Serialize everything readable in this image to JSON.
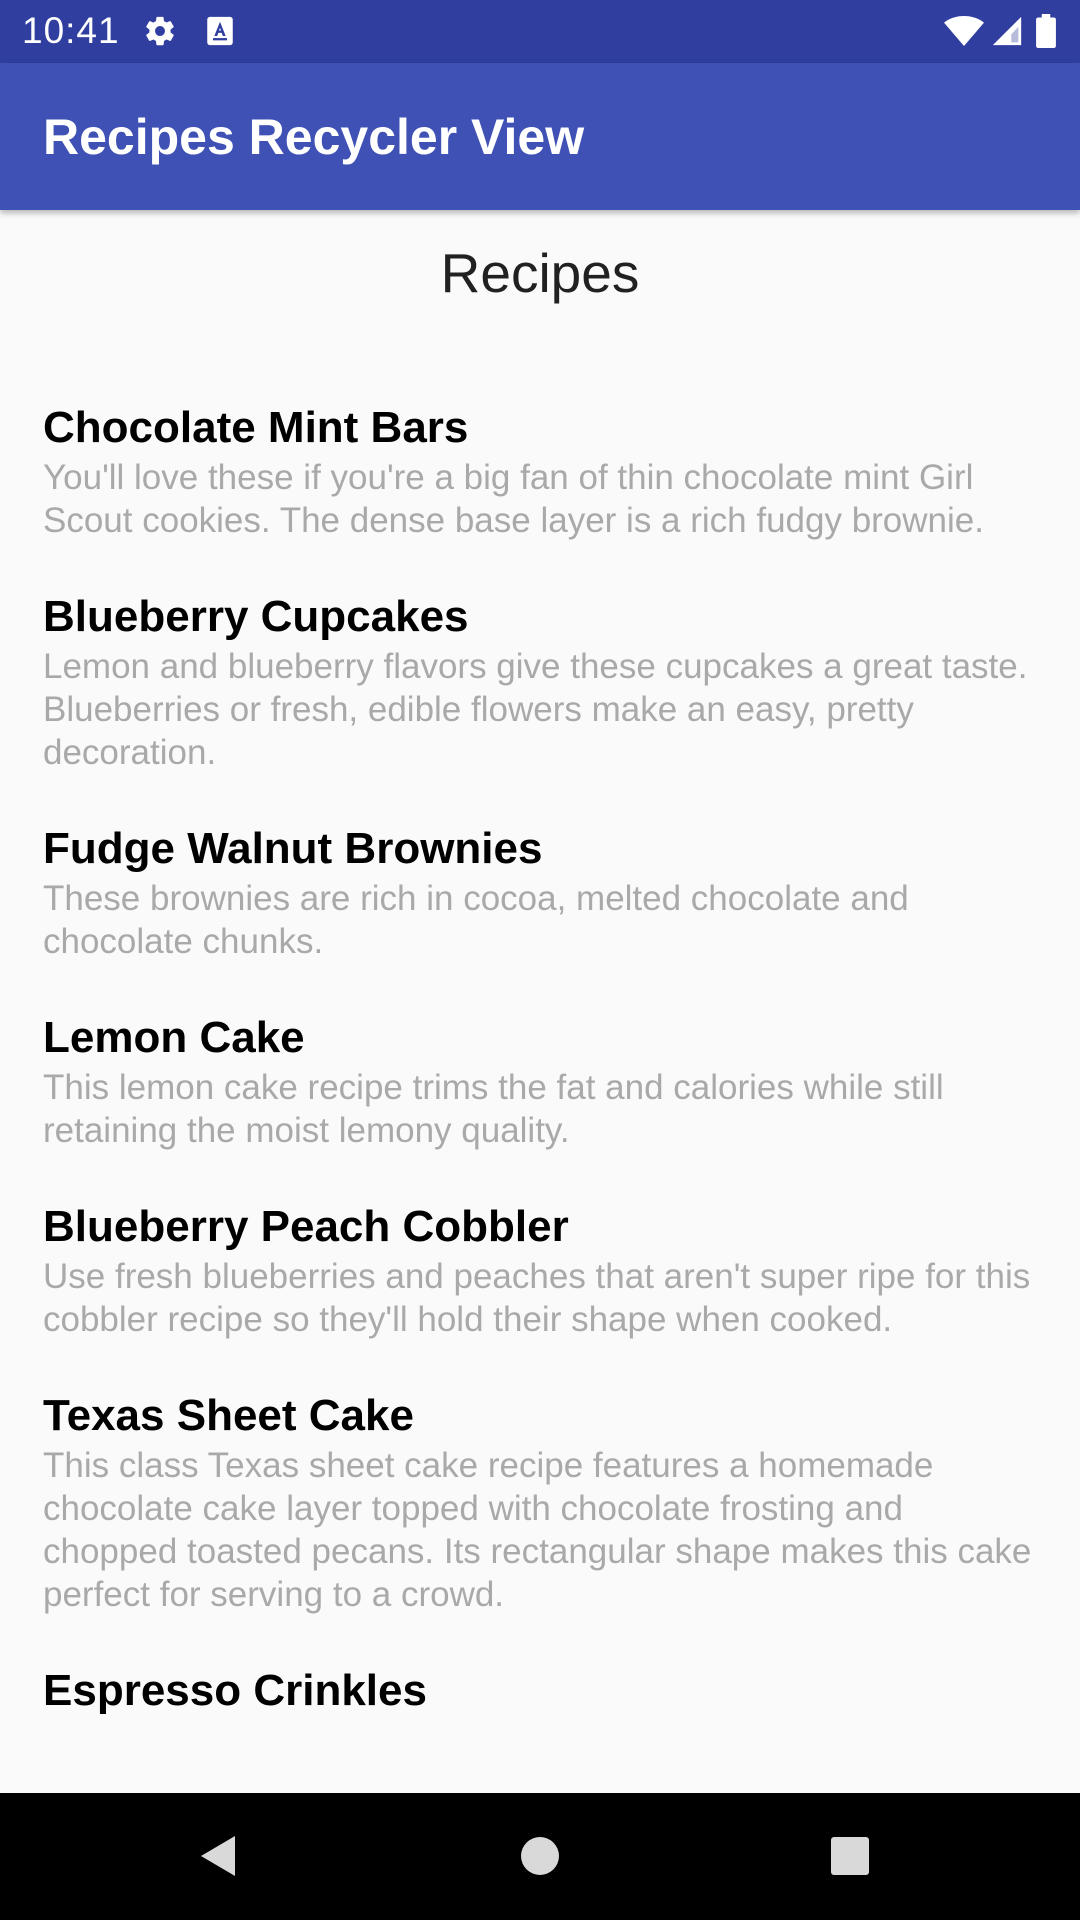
{
  "status_bar": {
    "time": "10:41",
    "left_icons": [
      "gear-icon",
      "font-a-icon"
    ],
    "right_icons": [
      "wifi-icon",
      "cell-signal-icon",
      "battery-icon"
    ]
  },
  "app_bar": {
    "title": "Recipes Recycler View",
    "color": "#3f51b5"
  },
  "heading": "Recipes",
  "recipes": [
    {
      "title": "Chocolate Mint Bars",
      "description": "You'll love these if you're a big fan of thin chocolate mint Girl Scout cookies. The dense base layer is a rich fudgy brownie."
    },
    {
      "title": "Blueberry Cupcakes",
      "description": "Lemon and blueberry flavors give these cupcakes a great taste. Blueberries or fresh, edible flowers make an easy, pretty decoration."
    },
    {
      "title": "Fudge Walnut Brownies",
      "description": "These brownies are rich in cocoa, melted chocolate and chocolate chunks."
    },
    {
      "title": "Lemon Cake",
      "description": "This lemon cake recipe trims the fat and calories while still retaining the moist lemony quality."
    },
    {
      "title": "Blueberry Peach Cobbler",
      "description": "Use fresh blueberries and peaches that aren't super ripe for this cobbler recipe so they'll hold their shape when cooked."
    },
    {
      "title": "Texas Sheet Cake",
      "description": "This class Texas sheet cake recipe features a homemade chocolate cake layer topped with chocolate frosting and chopped toasted pecans.  Its rectangular shape makes this cake perfect for serving to a crowd."
    },
    {
      "title": "Espresso Crinkles",
      "description": ""
    }
  ],
  "nav_bar": {
    "buttons": [
      "back-icon",
      "home-icon",
      "recents-icon"
    ]
  }
}
